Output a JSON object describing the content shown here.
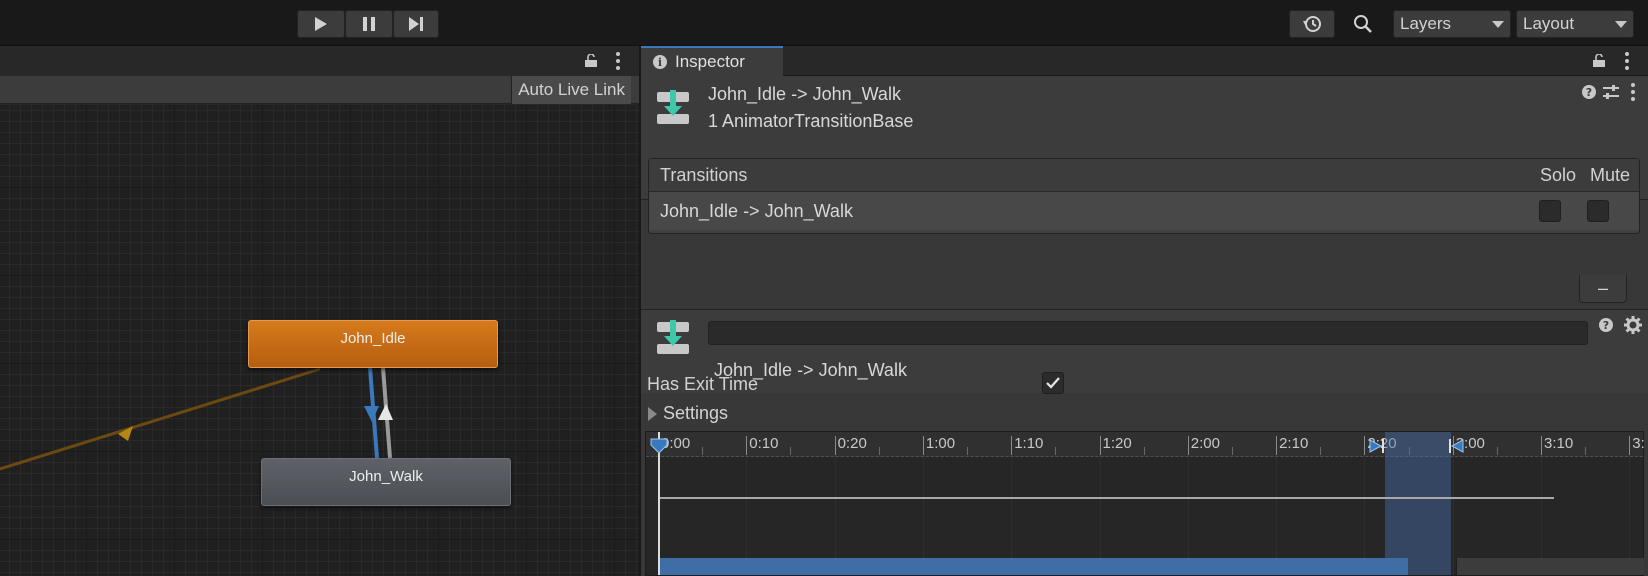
{
  "toolbar": {
    "play_icon": "play-icon",
    "pause_icon": "pause-icon",
    "step_icon": "step-icon",
    "history_icon": "history-icon",
    "search_icon": "search-icon",
    "layers_label": "Layers",
    "layout_label": "Layout"
  },
  "graph": {
    "auto_live_link": "Auto Live Link",
    "nodes": {
      "idle": "John_Idle",
      "walk": "John_Walk"
    },
    "colors": {
      "idle_node": "#c86a15",
      "walk_node": "#55575e",
      "transition_selected": "#3a79bb",
      "entry_arrow": "#6b4a12"
    }
  },
  "inspector": {
    "tab_label": "Inspector",
    "header": {
      "title": "John_Idle -> John_Walk",
      "subtitle": "1 AnimatorTransitionBase"
    },
    "transitions": {
      "header": "Transitions",
      "solo": "Solo",
      "mute": "Mute",
      "rows": [
        {
          "name": "John_Idle -> John_Walk",
          "solo": false,
          "mute": false
        }
      ],
      "remove_label": "–"
    },
    "transition": {
      "name_value": "",
      "display_name": "John_Idle -> John_Walk",
      "has_exit_time_label": "Has Exit Time",
      "has_exit_time": true,
      "settings_label": "Settings"
    },
    "timeline": {
      "labels": [
        "0:00",
        "0:10",
        "0:20",
        "1:00",
        "1:10",
        "1:20",
        "2:00",
        "2:10",
        "2:20",
        "3:00",
        "3:10",
        "3:"
      ]
    }
  }
}
